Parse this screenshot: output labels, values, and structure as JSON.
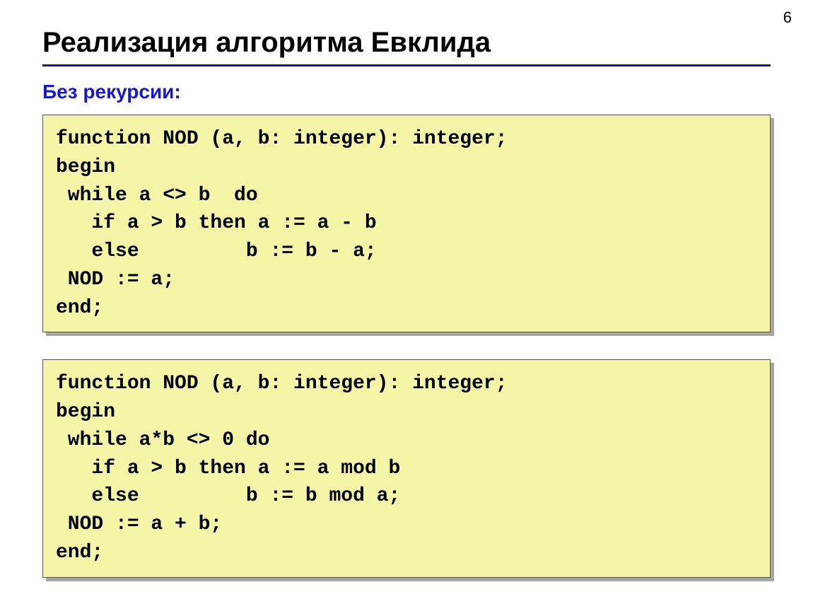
{
  "page_number": "6",
  "title": "Реализация алгоритма Евклида",
  "subtitle": "Без рекурсии:",
  "code_block_1": "function NOD (a, b: integer): integer;\nbegin\n while a <> b  do\n   if a > b then a := a - b\n   else         b := b - a;\n NOD := a;\nend;",
  "code_block_2": "function NOD (a, b: integer): integer;\nbegin\n while a*b <> 0 do\n   if a > b then a := a mod b\n   else         b := b mod a;\n NOD := a + b;\nend;"
}
